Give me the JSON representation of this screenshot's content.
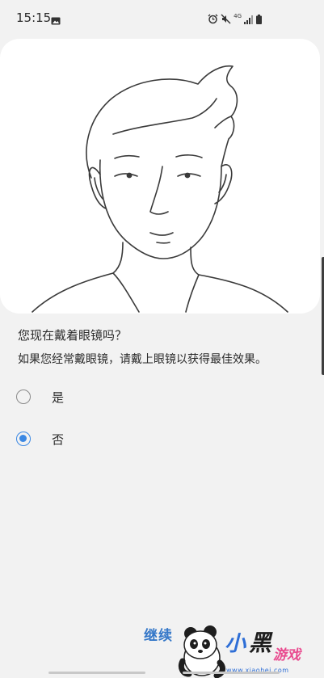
{
  "status_bar": {
    "time": "15:15",
    "network_label": "4G",
    "icons": [
      "image-icon",
      "alarm-icon",
      "mute-icon",
      "signal-icon",
      "battery-icon"
    ]
  },
  "illustration": {
    "icon": "face-outline-illustration"
  },
  "content": {
    "question": "您现在戴着眼镜吗？",
    "hint": "如果您经常戴眼镜，请戴上眼镜以获得最佳效果。"
  },
  "options": [
    {
      "label": "是",
      "selected": false
    },
    {
      "label": "否",
      "selected": true
    }
  ],
  "footer": {
    "continue_label": "继续"
  },
  "watermark": {
    "text_xiao": "小",
    "text_hei": "黑",
    "text_youxi": "游戏",
    "url": "www.xiaohei.com"
  },
  "colors": {
    "accent": "#3b88e3",
    "button_text": "#3477c8",
    "background": "#f2f2f2"
  }
}
